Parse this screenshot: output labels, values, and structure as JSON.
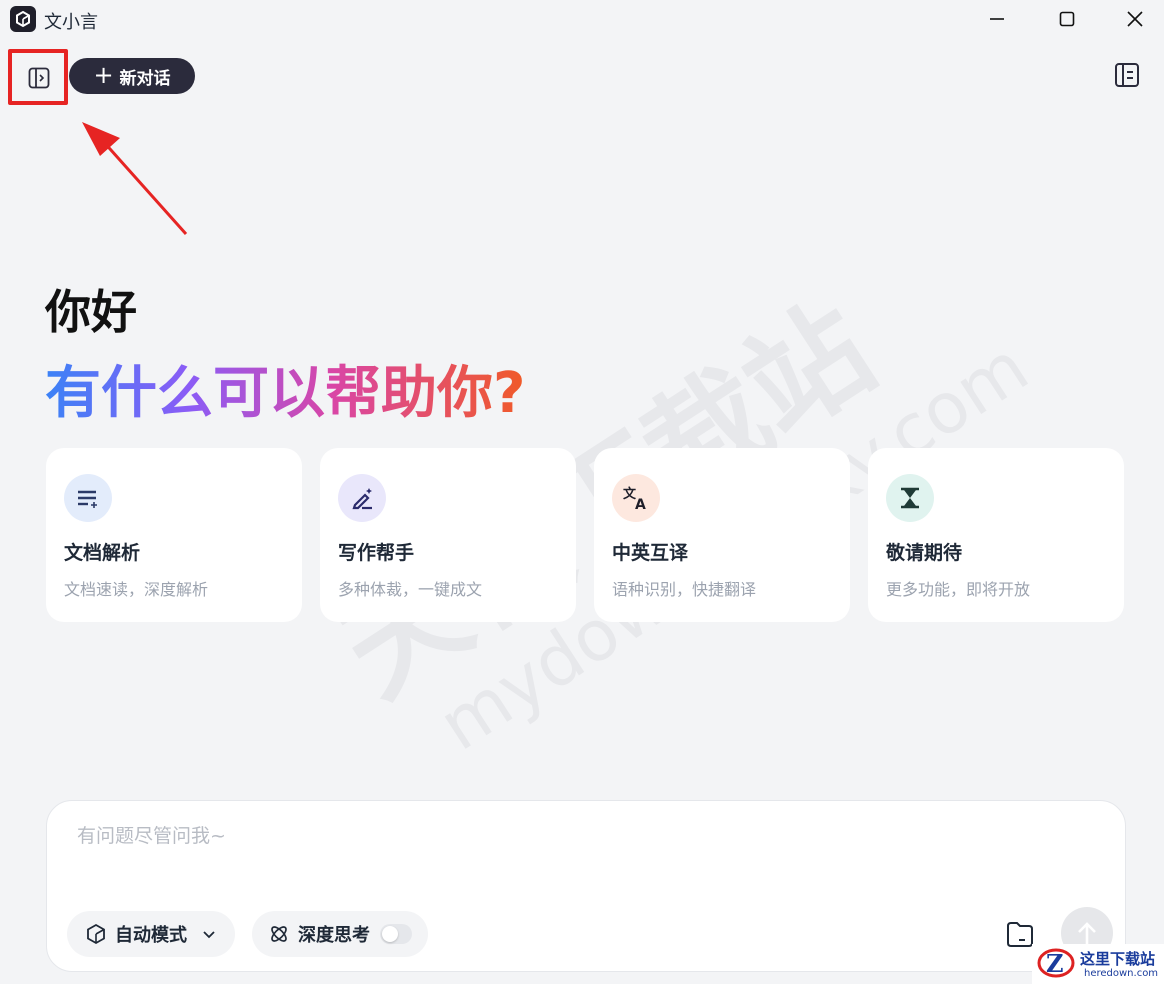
{
  "window": {
    "title": "文小言"
  },
  "toolbar": {
    "new_chat_label": "新对话"
  },
  "greeting": {
    "hello": "你好",
    "prompt": "有什么可以帮助你?"
  },
  "cards": [
    {
      "title": "文档解析",
      "subtitle": "文档速读，深度解析",
      "icon": "document-list-icon",
      "color": "#e3ecfb"
    },
    {
      "title": "写作帮手",
      "subtitle": "多种体裁，一键成文",
      "icon": "pen-sparkle-icon",
      "color": "#e9e7fb"
    },
    {
      "title": "中英互译",
      "subtitle": "语种识别，快捷翻译",
      "icon": "translate-icon",
      "color": "#fde8df"
    },
    {
      "title": "敬请期待",
      "subtitle": "更多功能，即将开放",
      "icon": "hourglass-icon",
      "color": "#e0f3ef"
    }
  ],
  "input": {
    "placeholder": "有问题尽管问我~",
    "mode_label": "自动模式",
    "think_label": "深度思考",
    "think_enabled": false
  },
  "watermark": {
    "line1": "天极下载站",
    "line2": "mydown.yesky.com"
  },
  "badge": {
    "name": "这里下载站",
    "url": "heredown.com"
  },
  "colors": {
    "accent_dark": "#2b2b3c",
    "highlight_box": "#e62423",
    "gradient": [
      "#3b82f6",
      "#8b5cf6",
      "#d946a6",
      "#f05a28"
    ]
  }
}
